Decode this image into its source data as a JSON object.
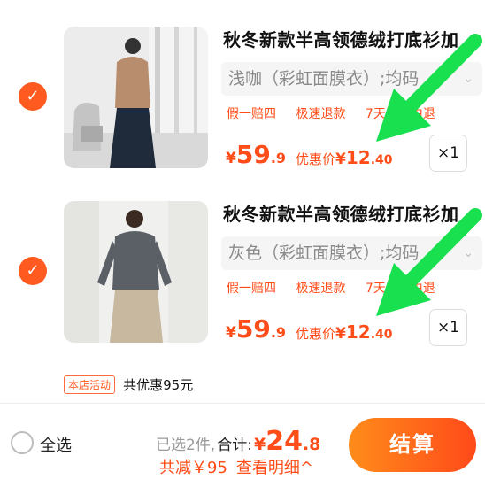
{
  "items": [
    {
      "title": "秋冬新款半高领德绒打底衫加",
      "variant": "浅咖（彩虹面膜衣）;均码",
      "tags": [
        "假一赔四",
        "极速退款",
        "7天无理由退"
      ],
      "price": {
        "currency": "¥",
        "int": "59",
        "dec": ".9"
      },
      "promo": {
        "label": "优惠价",
        "currency": "¥",
        "int": "12",
        "dec": ".40"
      },
      "qty": "×1",
      "colors": {
        "shirt": "#b88d6d"
      }
    },
    {
      "title": "秋冬新款半高领德绒打底衫加",
      "variant": "灰色（彩虹面膜衣）;均码",
      "tags": [
        "假一赔四",
        "极速退款",
        "7天无理由退"
      ],
      "price": {
        "currency": "¥",
        "int": "59",
        "dec": ".9"
      },
      "promo": {
        "label": "优惠价",
        "currency": "¥",
        "int": "12",
        "dec": ".40"
      },
      "qty": "×1",
      "colors": {
        "shirt": "#5b5f66"
      }
    }
  ],
  "store": {
    "badge": "本店活动",
    "text": "共优惠95元"
  },
  "footer": {
    "select_all": "全选",
    "selected": "已选2件,",
    "total_label": "合计:",
    "total": {
      "currency": "¥",
      "int": "24",
      "dec": ".8"
    },
    "discount": "共减￥95",
    "detail": "查看明细^",
    "checkout": "结算"
  },
  "colors": {
    "accent": "#ff4d19",
    "arrow": "#19e04f"
  }
}
